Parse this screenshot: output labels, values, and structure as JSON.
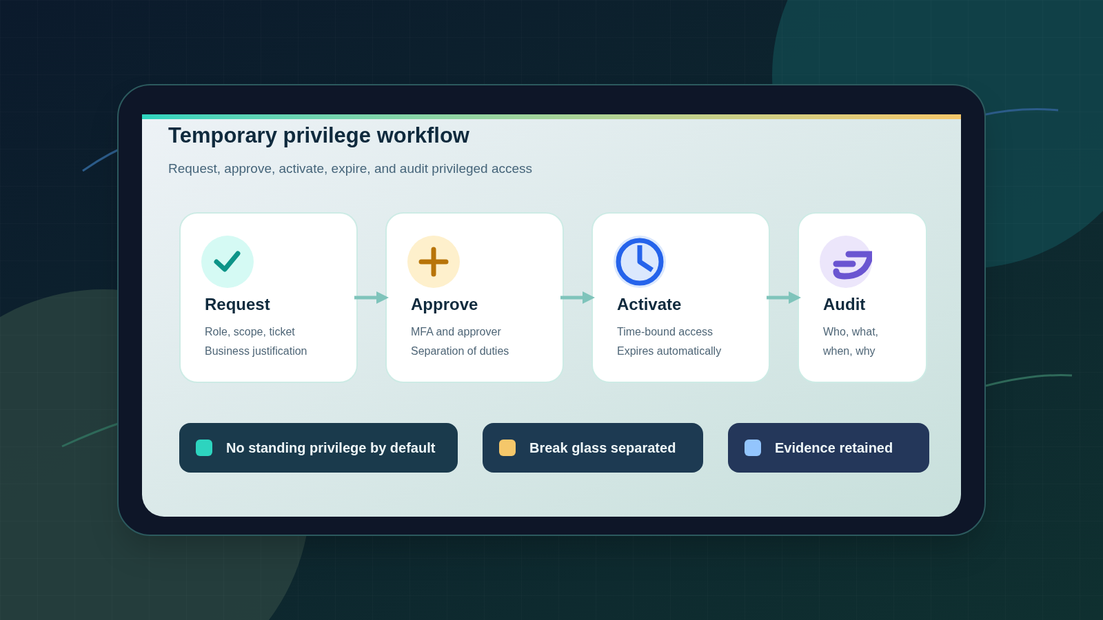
{
  "title": "Temporary privilege workflow",
  "subtitle": "Request, approve, activate, expire, and audit privileged access",
  "steps": [
    {
      "kind": "check",
      "title": "Request",
      "lines": [
        "Role, scope, ticket",
        "Business justification"
      ]
    },
    {
      "kind": "plus",
      "title": "Approve",
      "lines": [
        "MFA and approver",
        "Separation of duties"
      ]
    },
    {
      "kind": "clock",
      "title": "Activate",
      "lines": [
        "Time-bound access",
        "Expires automatically"
      ]
    },
    {
      "kind": "hook",
      "title": "Audit",
      "lines": [
        "Who, what,",
        "when, why"
      ]
    }
  ],
  "pills": [
    {
      "label": "No standing privilege by default",
      "color": "#2dd4bf"
    },
    {
      "label": "Break glass separated",
      "color": "#f5c76a"
    },
    {
      "label": "Evidence retained",
      "color": "#93c5fd"
    }
  ]
}
